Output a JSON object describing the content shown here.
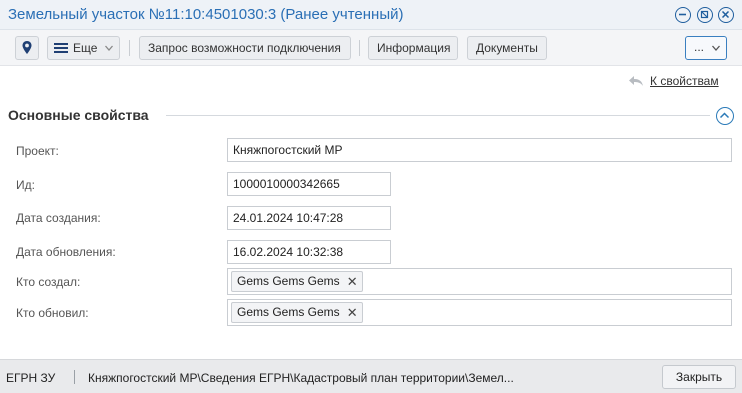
{
  "window": {
    "title": "Земельный участок №11:10:4501030:3 (Ранее учтенный)"
  },
  "toolbar": {
    "more_label": "Еще",
    "connect_request_label": "Запрос возможности подключения",
    "info_label": "Информация",
    "documents_label": "Документы",
    "overflow_label": "..."
  },
  "nav": {
    "back_to_properties": "К свойствам"
  },
  "section": {
    "title": "Основные свойства"
  },
  "fields": {
    "project": {
      "label": "Проект:",
      "value": "Княжпогостский МР"
    },
    "id": {
      "label": "Ид:",
      "value": "1000010000342665"
    },
    "created": {
      "label": "Дата создания:",
      "value": "24.01.2024 10:47:28"
    },
    "updated": {
      "label": "Дата обновления:",
      "value": "16.02.2024 10:32:38"
    },
    "created_by": {
      "label": "Кто создал:",
      "value": "Gems Gems Gems"
    },
    "updated_by": {
      "label": "Кто обновил:",
      "value": "Gems Gems Gems"
    }
  },
  "statusbar": {
    "object_type": "ЕГРН ЗУ",
    "path": "Княжпогостский МР\\Сведения ЕГРН\\Кадастровый план территории\\Земел...",
    "close_label": "Закрыть"
  },
  "colors": {
    "title_blue": "#2a6fb5",
    "accent_blue": "#1f5e9e"
  }
}
